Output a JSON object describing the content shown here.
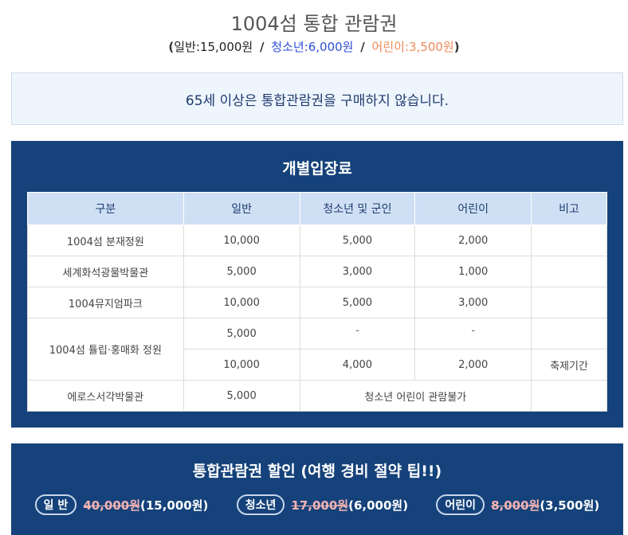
{
  "header": {
    "title": "1004섬 통합 관람권",
    "open_paren": "(",
    "close_paren": ")",
    "adult": "일반:15,000원",
    "youth": "청소년:6,000원",
    "child": "어린이:3,500원",
    "separator": "/"
  },
  "notice": "65세 이상은 통합관람권을 구매하지 않습니다.",
  "individual": {
    "title": "개별입장료",
    "columns": [
      "구분",
      "일반",
      "청소년 및 군인",
      "어린이",
      "비고"
    ],
    "rows": [
      {
        "name": "1004섬 분재정원",
        "adult": "10,000",
        "youth": "5,000",
        "child": "2,000",
        "note": ""
      },
      {
        "name": "세계화석광물박물관",
        "adult": "5,000",
        "youth": "3,000",
        "child": "1,000",
        "note": ""
      },
      {
        "name": "1004뮤지엄파크",
        "adult": "10,000",
        "youth": "5,000",
        "child": "3,000",
        "note": ""
      },
      {
        "name": "1004섬 튤립·홍매화 정원",
        "adult": "5,000",
        "youth": "-",
        "child": "-",
        "note": ""
      },
      {
        "name": "",
        "adult": "10,000",
        "youth": "4,000",
        "child": "2,000",
        "note": "축제기간"
      },
      {
        "name": "에로스서각박물관",
        "adult": "5,000",
        "merged": "청소년 어린이 관람불가",
        "note": ""
      }
    ]
  },
  "discount": {
    "title": "통합관람권 할인 (여행 경비 절약 팁!!)",
    "items": [
      {
        "label": "일 반",
        "old": "40,000원",
        "new": "(15,000원)"
      },
      {
        "label": "청소년",
        "old": "17,000원",
        "new": "(6,000원)"
      },
      {
        "label": "어린이",
        "old": "8,000원",
        "new": "(3,500원)"
      }
    ]
  },
  "colors": {
    "panel": "#15427a",
    "youth_price": "#2f4fd8",
    "child_price": "#f08a5a",
    "strike_price": "#f3b3b3"
  }
}
